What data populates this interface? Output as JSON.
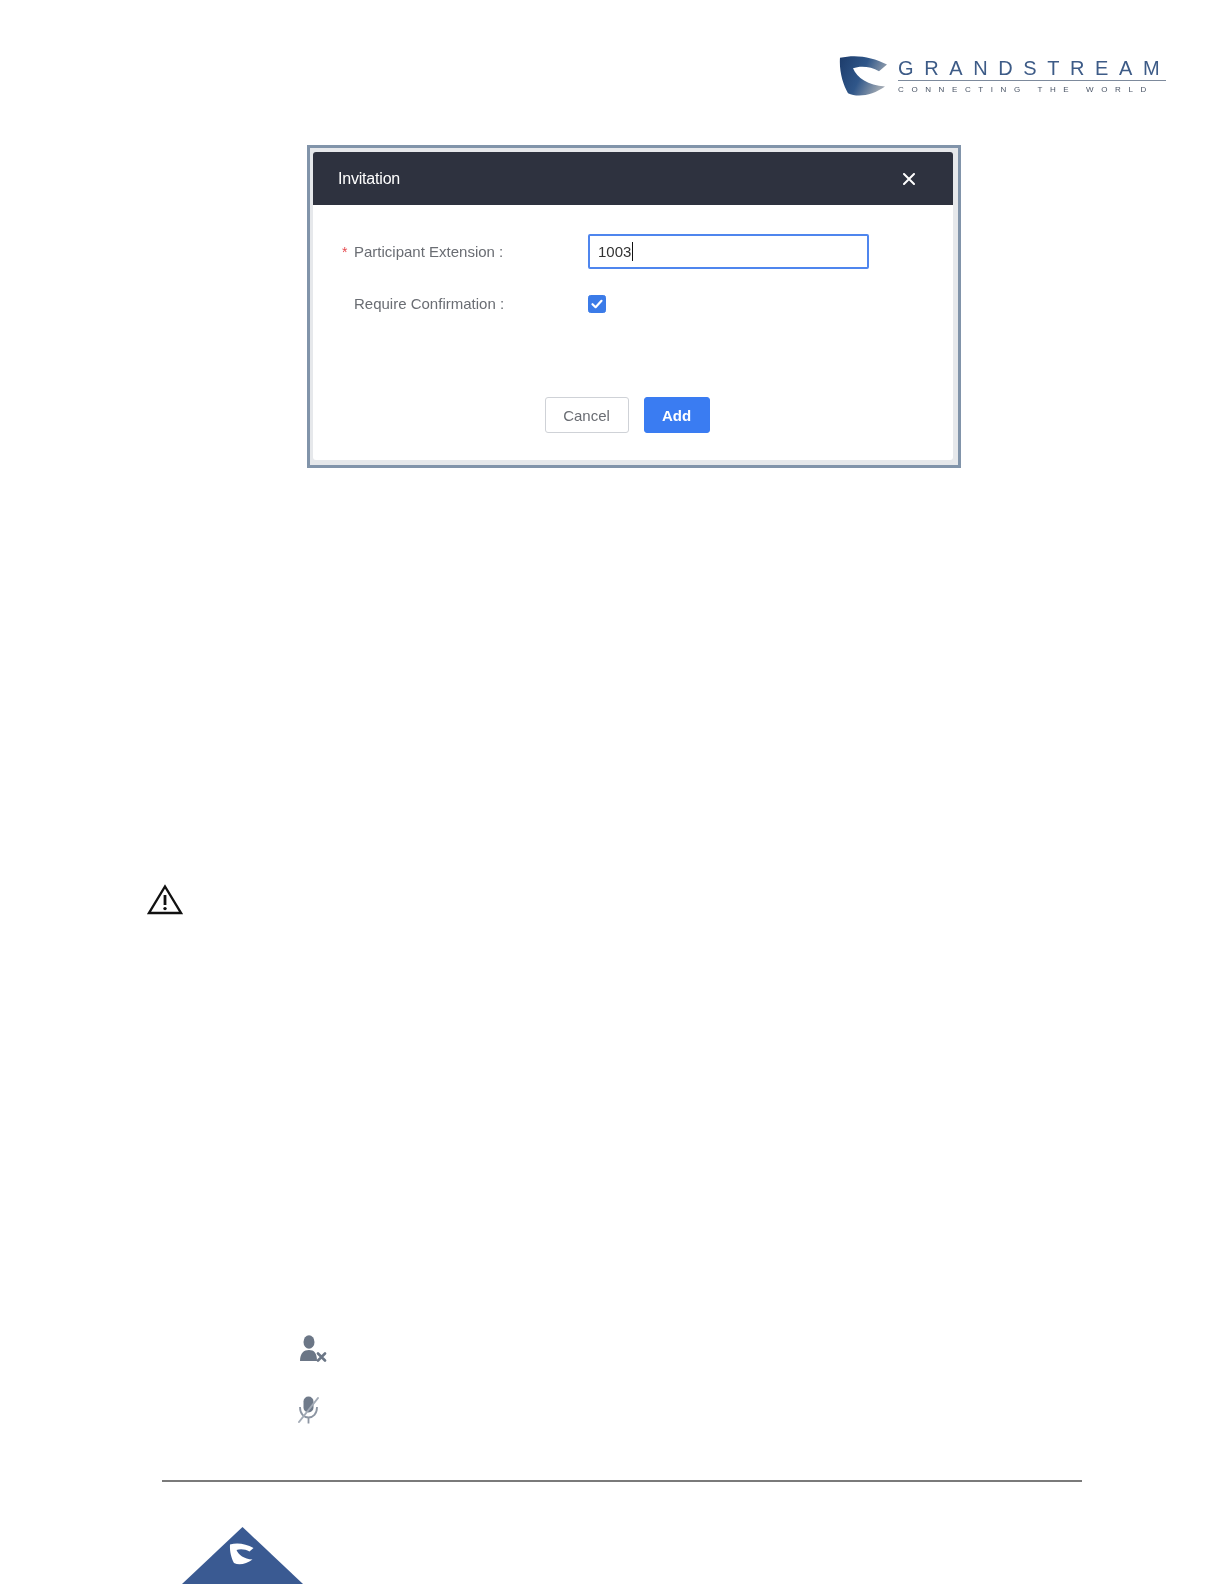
{
  "header": {
    "logo": {
      "name": "GRANDSTREAM",
      "tagline": "CONNECTING THE WORLD"
    }
  },
  "figure": {
    "dialog": {
      "title": "Invitation",
      "fields": [
        {
          "kind": "text",
          "required_mark": "*",
          "label": "Participant Extension :",
          "value": "1003",
          "focused": true
        },
        {
          "kind": "checkbox",
          "label": "Require Confirmation :",
          "checked": true
        }
      ],
      "buttons": [
        {
          "label": "Cancel",
          "kind": "default"
        },
        {
          "label": "Add",
          "kind": "primary"
        }
      ]
    }
  }
}
